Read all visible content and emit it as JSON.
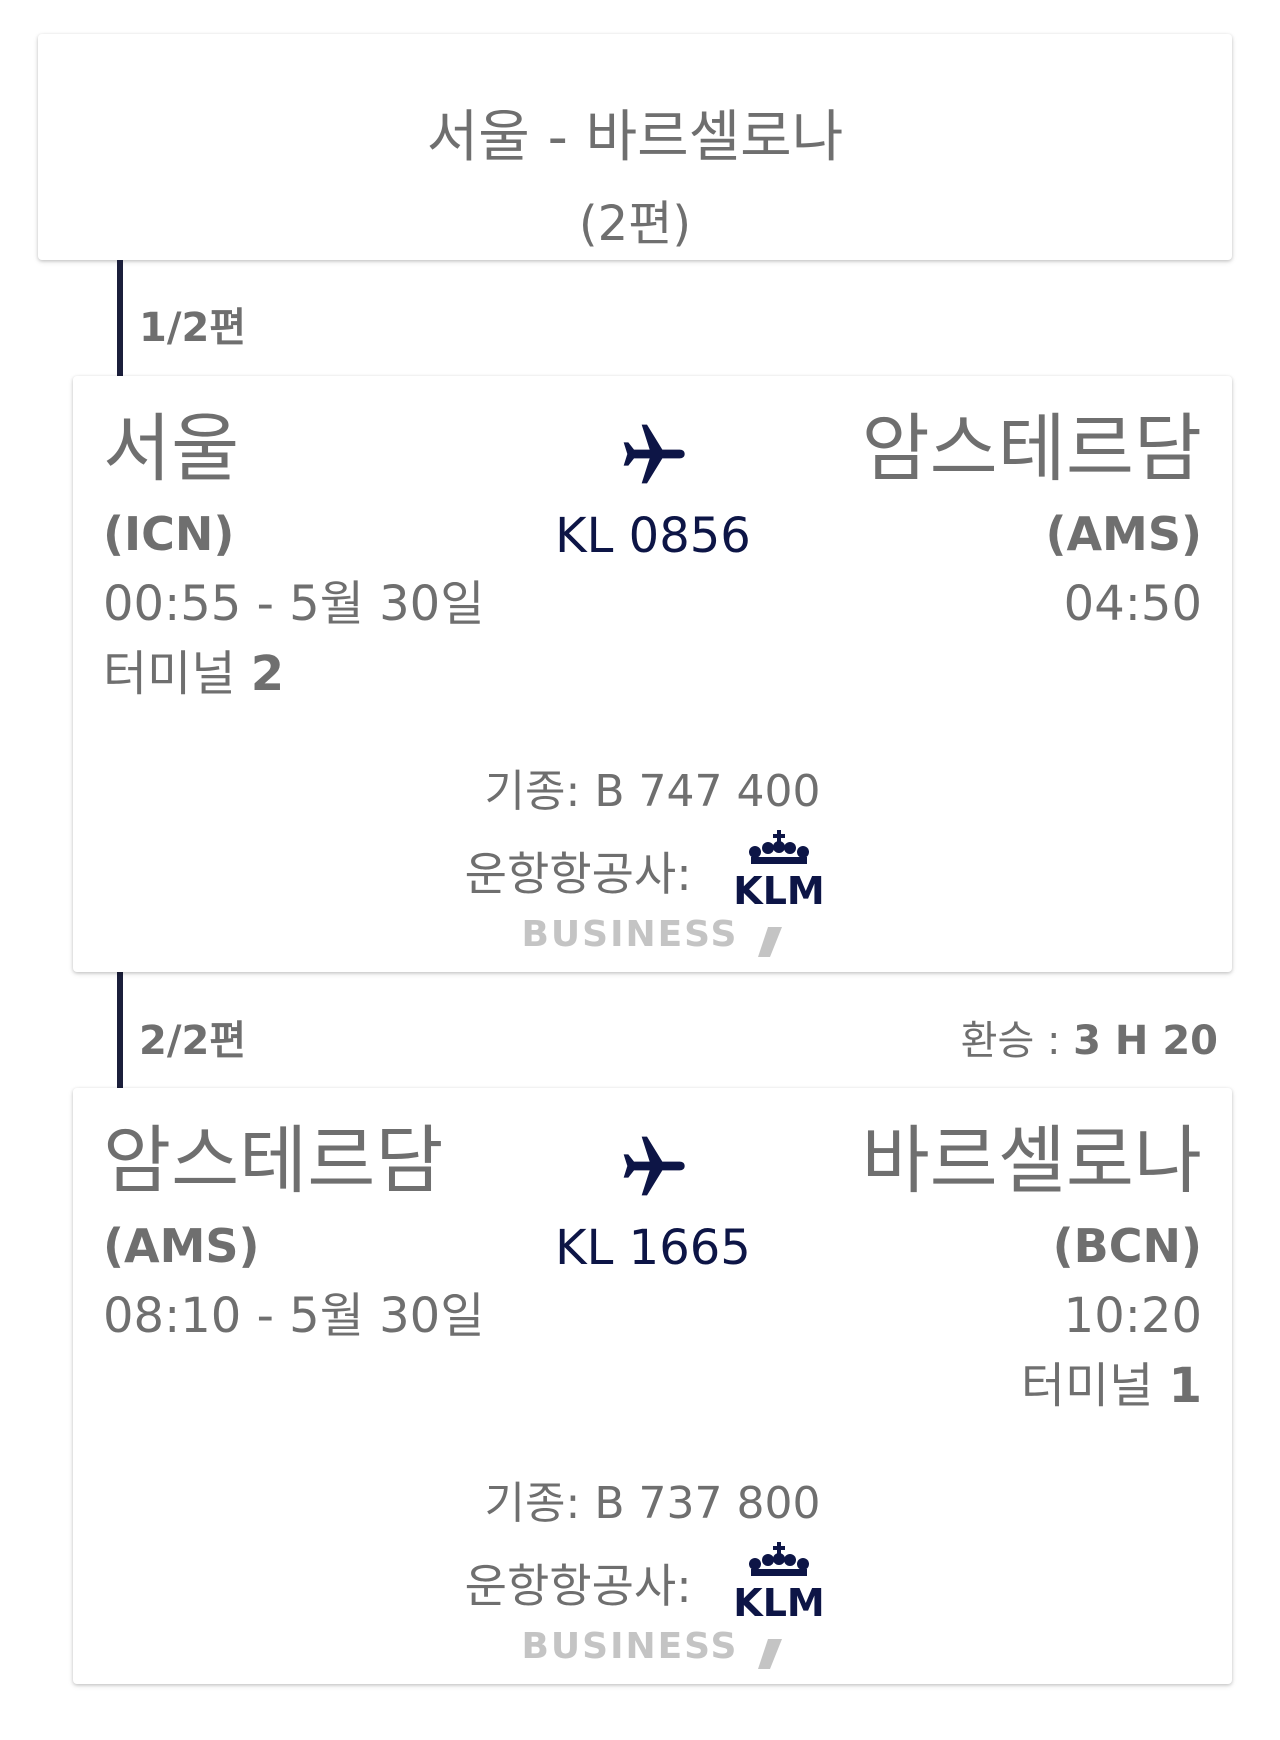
{
  "route": {
    "title": "서울 - 바르셀로나",
    "subtitle": "(2편)"
  },
  "legs": [
    {
      "label": "1/2편",
      "from_city": "서울",
      "from_code": "(ICN)",
      "from_time": "00:55 - 5월 30일",
      "from_terminal_label": "터미널",
      "from_terminal_no": "2",
      "flight_no": "KL 0856",
      "to_city": "암스테르담",
      "to_code": "(AMS)",
      "to_time": "04:50",
      "aircraft": "기종: B 747 400",
      "operator_label": "운항항공사:",
      "operator_logo": "KLM",
      "cabin": "BUSINESS"
    },
    {
      "label": "2/2편",
      "connection_label": "환승 :",
      "connection_time": "3 H 20",
      "from_city": "암스테르담",
      "from_code": "(AMS)",
      "from_time": "08:10 - 5월 30일",
      "flight_no": "KL 1665",
      "to_city": "바르셀로나",
      "to_code": "(BCN)",
      "to_time": "10:20",
      "to_terminal_label": "터미널",
      "to_terminal_no": "1",
      "aircraft": "기종: B 737 800",
      "operator_label": "운항항공사:",
      "operator_logo": "KLM",
      "cabin": "BUSINESS"
    }
  ],
  "colors": {
    "text": "#6f6f6f",
    "accent": "#0d1546",
    "timeline": "#1b1f3b",
    "cabin": "#c4c4c4"
  },
  "icons": {
    "plane": "airplane-icon",
    "airline_logo": "klm-logo-icon",
    "cabin_slash": "business-slash-icon"
  }
}
